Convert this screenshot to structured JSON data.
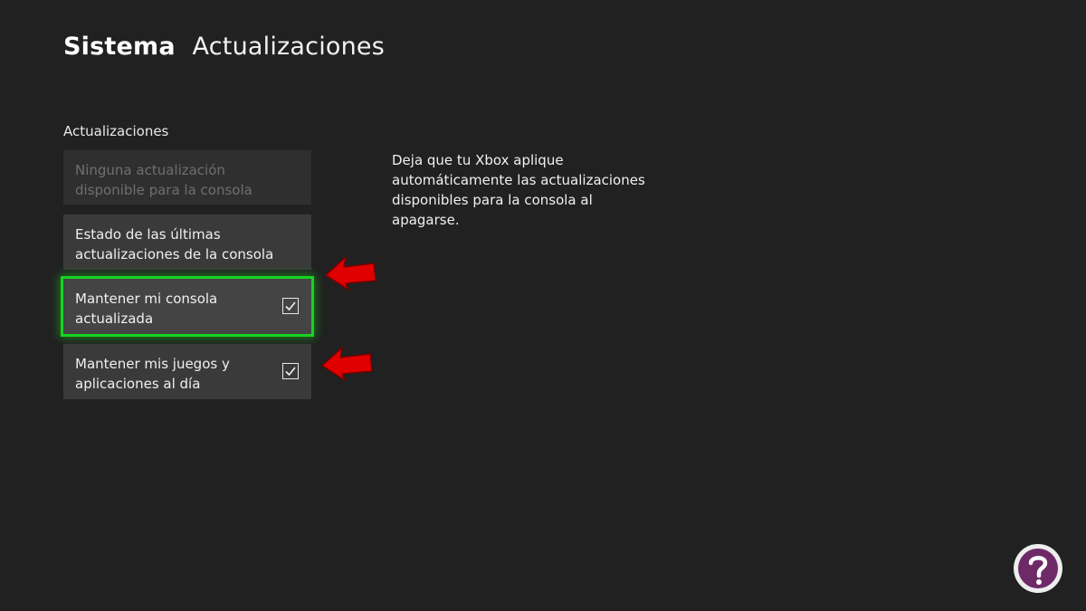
{
  "header": {
    "section": "Sistema",
    "subsection": "Actualizaciones"
  },
  "updates": {
    "group_label": "Actualizaciones",
    "items": [
      {
        "label": "Ninguna actualización disponible para la consola",
        "state": "disabled"
      },
      {
        "label": "Estado de las últimas actualizaciones de la consola",
        "state": "normal"
      },
      {
        "label": "Mantener mi consola actualizada",
        "state": "focused",
        "checked": true
      },
      {
        "label": "Mantener mis juegos y aplicaciones al día",
        "state": "normal",
        "checked": true
      }
    ]
  },
  "description": "Deja que tu Xbox aplique automáticamente las actualizaciones disponibles para la consola al apagarse.",
  "colors": {
    "background": "#212121",
    "tile": "#3a3a3a",
    "focus": "#17d321",
    "annotation_arrow": "#e10000"
  },
  "icons": {
    "checkbox": "checkmark-icon",
    "annotation": "red-arrow-icon",
    "watermark": "question-mark-logo-icon"
  }
}
